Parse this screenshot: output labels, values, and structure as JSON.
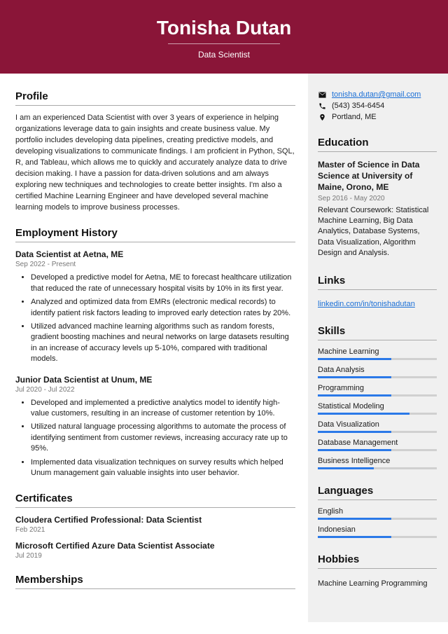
{
  "header": {
    "name": "Tonisha Dutan",
    "subtitle": "Data Scientist"
  },
  "profile": {
    "heading": "Profile",
    "text": "I am an experienced Data Scientist with over 3 years of experience in helping organizations leverage data to gain insights and create business value. My portfolio includes developing data pipelines, creating predictive models, and developing visualizations to communicate findings. I am proficient in Python, SQL, R, and Tableau, which allows me to quickly and accurately analyze data to drive decision making. I have a passion for data-driven solutions and am always exploring new techniques and technologies to create better insights. I'm also a certified Machine Learning Engineer and have developed several machine learning models to improve business processes."
  },
  "employment": {
    "heading": "Employment History",
    "jobs": [
      {
        "title": "Data Scientist at Aetna, ME",
        "dates": "Sep 2022 - Present",
        "bullets": [
          "Developed a predictive model for Aetna, ME to forecast healthcare utilization that reduced the rate of unnecessary hospital visits by 10% in its first year.",
          "Analyzed and optimized data from EMRs (electronic medical records) to identify patient risk factors leading to improved early detection rates by 20%.",
          "Utilized advanced machine learning algorithms such as random forests, gradient boosting machines and neural networks on large datasets resulting in an increase of accuracy levels up 5-10%, compared with traditional models."
        ]
      },
      {
        "title": "Junior Data Scientist at Unum, ME",
        "dates": "Jul 2020 - Jul 2022",
        "bullets": [
          "Developed and implemented a predictive analytics model to identify high-value customers, resulting in an increase of customer retention by 10%.",
          "Utilized natural language processing algorithms to automate the process of identifying sentiment from customer reviews, increasing accuracy rate up to 95%.",
          "Implemented data visualization techniques on survey results which helped Unum management gain valuable insights into user behavior."
        ]
      }
    ]
  },
  "certificates": {
    "heading": "Certificates",
    "items": [
      {
        "title": "Cloudera Certified Professional: Data Scientist",
        "date": "Feb 2021"
      },
      {
        "title": "Microsoft Certified Azure Data Scientist Associate",
        "date": "Jul 2019"
      }
    ]
  },
  "memberships": {
    "heading": "Memberships"
  },
  "contact": {
    "email": "tonisha.dutan@gmail.com",
    "phone": "(543) 354-6454",
    "location": "Portland, ME"
  },
  "education": {
    "heading": "Education",
    "degree": "Master of Science in Data Science at University of Maine, Orono, ME",
    "dates": "Sep 2016 - May 2020",
    "desc": "Relevant Coursework: Statistical Machine Learning, Big Data Analytics, Database Systems, Data Visualization, Algorithm Design and Analysis."
  },
  "links": {
    "heading": "Links",
    "items": [
      {
        "text": "linkedin.com/in/tonishadutan"
      }
    ]
  },
  "skills": {
    "heading": "Skills",
    "items": [
      {
        "name": "Machine Learning",
        "pct": 62
      },
      {
        "name": "Data Analysis",
        "pct": 62
      },
      {
        "name": "Programming",
        "pct": 62
      },
      {
        "name": "Statistical Modeling",
        "pct": 77
      },
      {
        "name": "Data Visualization",
        "pct": 62
      },
      {
        "name": "Database Management",
        "pct": 62
      },
      {
        "name": "Business Intelligence",
        "pct": 47
      }
    ]
  },
  "languages": {
    "heading": "Languages",
    "items": [
      {
        "name": "English",
        "pct": 62
      },
      {
        "name": "Indonesian",
        "pct": 62
      }
    ]
  },
  "hobbies": {
    "heading": "Hobbies",
    "items": [
      "Machine Learning Programming"
    ]
  }
}
